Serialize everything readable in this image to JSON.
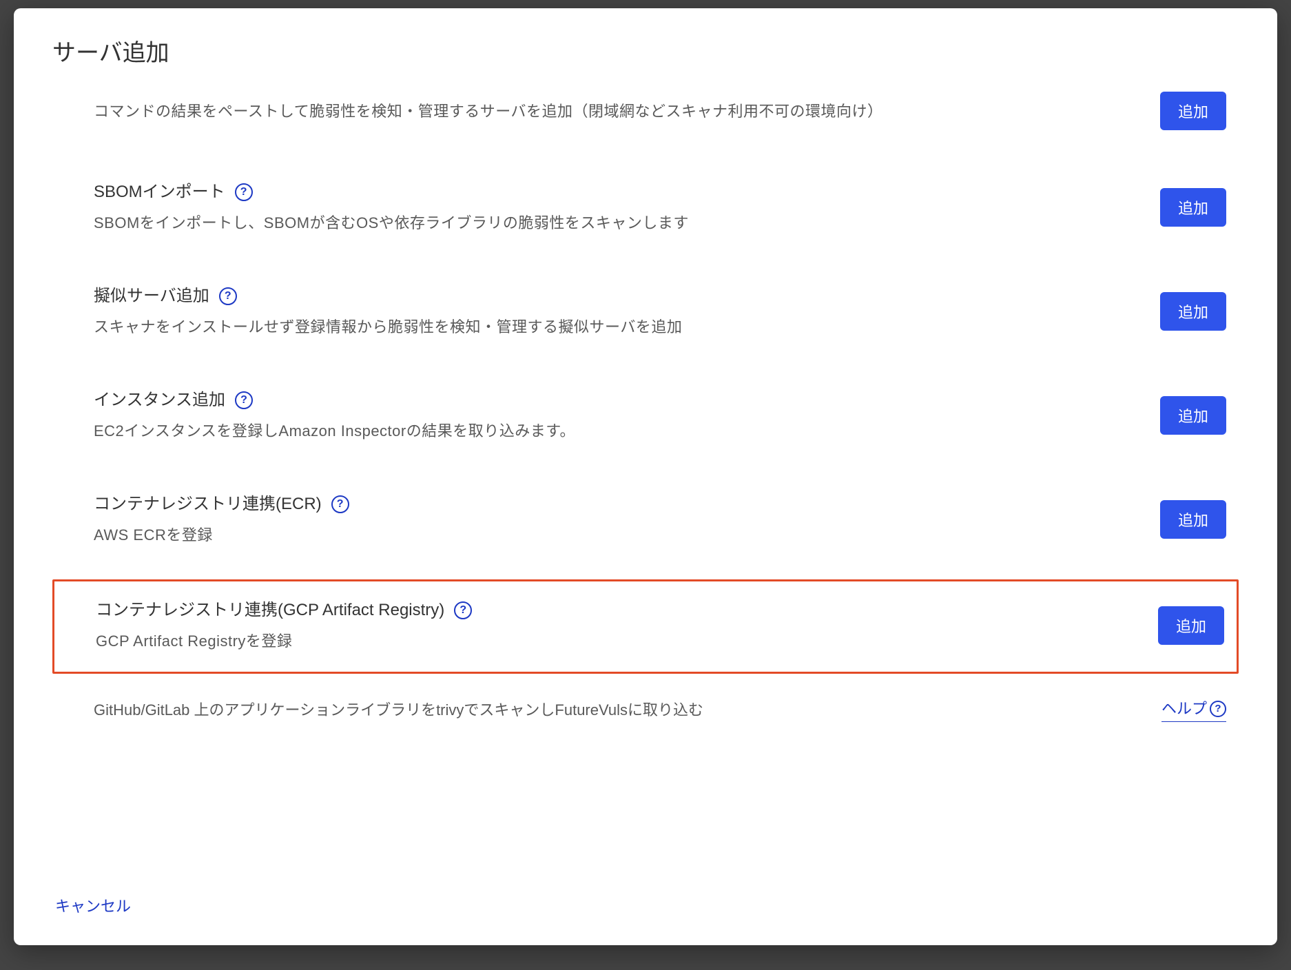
{
  "modal": {
    "title": "サーバ追加",
    "add_label": "追加",
    "help_text": "ヘルプ",
    "cancel_label": "キャンセル",
    "footer_note": "GitHub/GitLab 上のアプリケーションライブラリをtrivyでスキャンしFutureVulsに取り込む",
    "sections": [
      {
        "id": "paste-result",
        "title": "",
        "desc": "コマンドの結果をペーストして脆弱性を検知・管理するサーバを追加（閉域網などスキャナ利用不可の環境向け）"
      },
      {
        "id": "sbom-import",
        "title": "SBOMインポート",
        "desc": "SBOMをインポートし、SBOMが含むOSや依存ライブラリの脆弱性をスキャンします"
      },
      {
        "id": "pseudo-server",
        "title": "擬似サーバ追加",
        "desc": "スキャナをインストールせず登録情報から脆弱性を検知・管理する擬似サーバを追加"
      },
      {
        "id": "instance-add",
        "title": "インスタンス追加",
        "desc": "EC2インスタンスを登録しAmazon Inspectorの結果を取り込みます。"
      },
      {
        "id": "container-ecr",
        "title": "コンテナレジストリ連携(ECR)",
        "desc": "AWS ECRを登録"
      },
      {
        "id": "container-gcp",
        "title": "コンテナレジストリ連携(GCP Artifact Registry)",
        "desc": "GCP Artifact Registryを登録"
      }
    ]
  }
}
